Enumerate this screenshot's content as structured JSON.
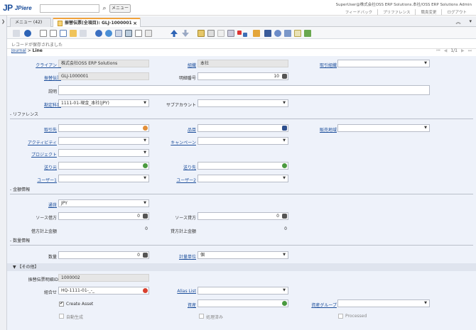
{
  "app": {
    "brand_mark": "JP",
    "brand_name": "JPiere"
  },
  "header": {
    "search_placeholder": "",
    "menu_button": "メニュー",
    "user_info": "SuperUser@株式会社OSS ERP Solutions.本社/OSS ERP Solutions Admin",
    "links": [
      "フィードバック",
      "プリファレンス",
      "職責変更",
      "ログアウト"
    ]
  },
  "tabs": [
    {
      "label": "メニュー (42)"
    },
    {
      "label": "振替伝票(全項目): GLJ-1000001"
    }
  ],
  "status": {
    "message": "レコードが保存されました"
  },
  "breadcrumb": {
    "parent": "Journal",
    "sep": ">",
    "current": "Line"
  },
  "pager": {
    "page": "1/1"
  },
  "form": {
    "client_label": "クライアント",
    "client_value": "株式会社OSS ERP Solutions",
    "org_label": "組織",
    "org_value": "本社",
    "trx_org_label": "取引組織",
    "trx_org_value": "",
    "journal_label": "振替伝票",
    "journal_value": "GLJ-1000001",
    "line_no_label": "明細番号",
    "line_no_value": "10",
    "desc_label": "説明",
    "desc_value": "",
    "account_label": "勘定科目",
    "account_value": "1111-01-現金_本社(JPY)",
    "subaccount_label": "サブアカウント",
    "subaccount_value": "",
    "section_reference": "- リファレンス",
    "bpartner_label": "取引先",
    "product_label": "品目",
    "sales_region_label": "販売地域",
    "activity_label": "アクティビティ",
    "campaign_label": "キャンペーン",
    "project_label": "プロジェクト",
    "ship_from_label": "送り元",
    "ship_to_label": "送り先",
    "user1_label": "ユーザー1",
    "user2_label": "ユーザー2",
    "section_amount": "- 金額情報",
    "currency_label": "通貨",
    "currency_value": "JPY",
    "src_debit_label": "ソース借方",
    "src_debit_value": "0",
    "src_credit_label": "ソース貸方",
    "src_credit_value": "0",
    "acct_debit_label": "借方計上金額",
    "acct_debit_value": "0",
    "acct_credit_label": "貸方計上金額",
    "acct_credit_value": "0",
    "section_qty": "- 数量情報",
    "qty_label": "数量",
    "qty_value": "0",
    "uom_label": "計量単位",
    "uom_value": "個",
    "section_other": "【その他】",
    "line_id_label": "振替伝票明細ID",
    "line_id_value": "1000002",
    "combination_label": "組合せ",
    "combination_value": "HQ-1111-01-_-_",
    "alias_label": "Alias List",
    "alias_value": "",
    "create_asset_label": "Create Asset",
    "asset_label": "資産",
    "asset_value": "",
    "asset_group_label": "資産グループ",
    "asset_group_value": "",
    "generated_label": "自動生成",
    "processed_label": "処理済み",
    "processed_en_label": "Processed"
  }
}
